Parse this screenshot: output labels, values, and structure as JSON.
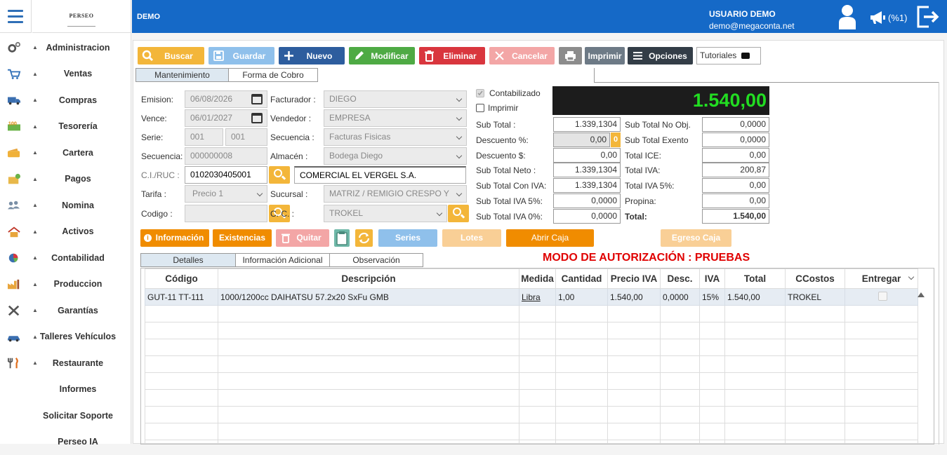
{
  "app": {
    "logo_text": "PERSEO"
  },
  "topbar": {
    "company": "DEMO",
    "user": "USUARIO DEMO",
    "email": "demo@megaconta.net",
    "percent_label": "(%1)"
  },
  "sidebar": {
    "items": [
      {
        "label": "Administracion",
        "icon": "gears-icon",
        "arrow": "▲"
      },
      {
        "label": "Ventas",
        "icon": "cart-icon",
        "arrow": "▲"
      },
      {
        "label": "Compras",
        "icon": "truck-icon",
        "arrow": "▲"
      },
      {
        "label": "Tesorería",
        "icon": "money-icon",
        "arrow": "▲"
      },
      {
        "label": "Cartera",
        "icon": "wallet-icon",
        "arrow": "▲"
      },
      {
        "label": "Pagos",
        "icon": "payment-icon",
        "arrow": "▲"
      },
      {
        "label": "Nomina",
        "icon": "people-icon",
        "arrow": "▲"
      },
      {
        "label": "Activos",
        "icon": "house-icon",
        "arrow": "▲"
      },
      {
        "label": "Contabilidad",
        "icon": "pie-chart-icon",
        "arrow": "▲"
      },
      {
        "label": "Produccion",
        "icon": "factory-icon",
        "arrow": "▲"
      },
      {
        "label": "Garantías",
        "icon": "tools-icon",
        "arrow": "▲"
      },
      {
        "label": "Talleres Vehículos",
        "icon": "car-icon",
        "arrow": "▲"
      },
      {
        "label": "Restaurante",
        "icon": "fork-knife-icon",
        "arrow": "▲"
      },
      {
        "label": "Informes",
        "icon": "",
        "arrow": ""
      },
      {
        "label": "Solicitar Soporte",
        "icon": "",
        "arrow": ""
      },
      {
        "label": "Perseo IA",
        "icon": "",
        "arrow": ""
      }
    ]
  },
  "toolbar": {
    "buscar": "Buscar",
    "guardar": "Guardar",
    "nuevo": "Nuevo",
    "modificar": "Modificar",
    "eliminar": "Eliminar",
    "cancelar": "Cancelar",
    "imprimir": "Imprimir",
    "opciones": "Opciones",
    "tutoriales": "Tutoriales"
  },
  "tabs": {
    "mantenimiento": "Mantenimiento",
    "forma_cobro": "Forma de Cobro"
  },
  "form": {
    "emision_label": "Emision:",
    "emision": "06/08/2026",
    "vence_label": "Vence:",
    "vence": "06/01/2027",
    "serie_label": "Serie:",
    "serie1": "001",
    "serie2": "001",
    "secuencia_label": "Secuencia:",
    "secuencia": "000000008",
    "ruc_label": "C.I./RUC :",
    "ruc": "0102030405001",
    "cliente": "COMERCIAL EL VERGEL S.A.",
    "tarifa_label": "Tarifa :",
    "tarifa": "Precio 1",
    "codigo_label": "Codigo :",
    "codigo": "",
    "facturador_label": "Facturador :",
    "facturador": "DIEGO",
    "vendedor_label": "Vendedor :",
    "vendedor": "EMPRESA",
    "secuencia2_label": "Secuencia :",
    "secuencia2": "Facturas Fisicas",
    "almacen_label": "Almacén :",
    "almacen": "Bodega Diego",
    "sucursal_label": "Sucursal :",
    "sucursal": "MATRIZ / REMIGIO CRESPO Y",
    "cc_label": "C. C. :",
    "cc": "TROKEL"
  },
  "options": {
    "contabilizado": "Contabilizado",
    "imprimir": "Imprimir"
  },
  "total_display": "1.540,00",
  "totals_left": [
    {
      "label": "Sub Total :",
      "value": "1.339,1304"
    },
    {
      "label": "Descuento %:",
      "value": "0,00",
      "badge": "0"
    },
    {
      "label": "Descuento $:",
      "value": "0,00"
    },
    {
      "label": "Sub Total Neto :",
      "value": "1.339,1304"
    },
    {
      "label": "Sub Total Con IVA:",
      "value": "1.339,1304"
    },
    {
      "label": "Sub Total IVA 5%:",
      "value": "0,0000"
    },
    {
      "label": "Sub Total IVA 0%:",
      "value": "0,0000"
    }
  ],
  "totals_right": [
    {
      "label": "Sub Total No Obj.",
      "value": "0,0000"
    },
    {
      "label": "Sub Total Exento",
      "value": "0,0000"
    },
    {
      "label": "Total ICE:",
      "value": "0,00"
    },
    {
      "label": "Total IVA:",
      "value": "200,87"
    },
    {
      "label": "Total IVA 5%:",
      "value": "0,00"
    },
    {
      "label": "Propina:",
      "value": "0,00"
    },
    {
      "label": "Total:",
      "value": "1.540,00"
    }
  ],
  "actions": {
    "informacion": "Información",
    "existencias": "Existencias",
    "quitar": "Quitar",
    "series": "Series",
    "lotes": "Lotes",
    "abrir_caja": "Abrir Caja",
    "egreso_caja": "Egreso Caja"
  },
  "mode_text": "MODO DE AUTORIZACIÓN : PRUEBAS",
  "detail_tabs": {
    "detalles": "Detalles",
    "info_adicional": "Información Adicional",
    "observacion": "Observación"
  },
  "grid": {
    "headers": [
      "Código",
      "Descripción",
      "Medida",
      "Cantidad",
      "Precio IVA",
      "Desc.",
      "IVA",
      "Total",
      "CCostos",
      "Entregar"
    ],
    "row": {
      "codigo": "GUT-11 TT-111",
      "descripcion": "1000/1200cc DAIHATSU 57.2x20 SxFu GMB",
      "medida": "Libra",
      "cantidad": "1,00",
      "precio": "1.540,00",
      "desc": "0,0000",
      "iva": "15%",
      "total": "1.540,00",
      "ccostos": "TROKEL"
    }
  },
  "colors": {
    "blue": "#1569c7",
    "yellow": "#f3b63a",
    "green": "#4eaa44",
    "red": "#d9363e",
    "orange": "#f08c00",
    "dark": "#333d47",
    "total_green": "#22dd22"
  }
}
